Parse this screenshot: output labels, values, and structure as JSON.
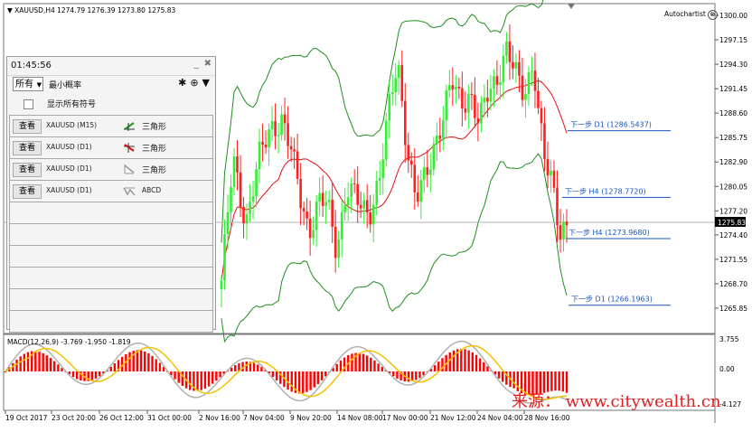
{
  "symbol_bar": {
    "text": "XAUUSD,H4  1274.79 1276.39 1273.80 1275.83"
  },
  "autochartist": {
    "label": "Autochartist"
  },
  "panel": {
    "time": "01:45:56",
    "filter_value": "所有",
    "min_prob_label": "最小概率",
    "show_all_label": "显示所有符号",
    "rows": [
      {
        "button": "查看",
        "symbol": "XAUUSD (M15)",
        "pattern": "三角形",
        "icon": "triangle-up-icon"
      },
      {
        "button": "查看",
        "symbol": "XAUUSD (D1)",
        "pattern": "三角形",
        "icon": "triangle-down-icon"
      },
      {
        "button": "查看",
        "symbol": "XAUUSD (D1)",
        "pattern": "三角形",
        "icon": "triangle-down-icon"
      },
      {
        "button": "查看",
        "symbol": "XAUUSD (D1)",
        "pattern": "ABCD",
        "icon": "abcd-icon"
      }
    ]
  },
  "macd": {
    "label": "MACD(12,26,9) -3.769 -1.950 -1.819"
  },
  "watermark": "来源：  www.citywealth.cn",
  "chart_data": {
    "type": "candlestick",
    "price_axis": {
      "ticks": [
        "1300.00",
        "1297.15",
        "1294.30",
        "1291.45",
        "1288.60",
        "1285.75",
        "1282.90",
        "1280.05",
        "1277.20",
        "1274.40",
        "1271.55",
        "1268.70",
        "1265.85"
      ],
      "current": "1275.83",
      "range": [
        1263.5,
        1301.5
      ]
    },
    "time_axis": [
      "19 Oct 2017",
      "23 Oct 20:00",
      "26 Oct 12:00",
      "31 Oct 00:00",
      "2 Nov 16:00",
      "7 Nov 04:00",
      "9 Nov 20:00",
      "14 Nov 08:00",
      "17 Nov 00:00",
      "21 Nov 12:00",
      "24 Nov 04:00",
      "28 Nov 16:00"
    ],
    "levels": [
      {
        "label": "下一步 D1 (1286.5437)",
        "value": 1286.5437
      },
      {
        "label": "下一步 H4 (1278.7720)",
        "value": 1278.772
      },
      {
        "label": "下一步 H4 (1273.9680)",
        "value": 1273.968
      },
      {
        "label": "下一步 D1 (1266.1963)",
        "value": 1266.1963
      }
    ],
    "macd_axis": [
      "3.755",
      "0.00",
      "-4.127"
    ],
    "colors": {
      "bull": "#33ee33",
      "bear": "#ff1f1f",
      "bb": "#1f8f1f",
      "ma": "#e01010",
      "level": "#1a55c0",
      "signal": "#f2c200",
      "macd_main": "#b0b0b0",
      "hist": "#ff0000"
    }
  }
}
